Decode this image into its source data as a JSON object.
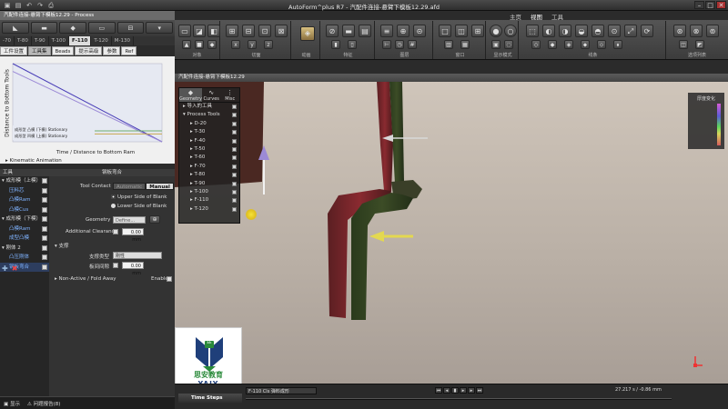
{
  "window": {
    "title": "AutoForm^plus R7 - 汽配件连接-悬臂下模板12.29.afd",
    "panel_title": "汽配件连接-悬臂下模板12.29 - Process",
    "view_title": "汽配件连接-悬臂下模板12.29",
    "menu_tabs": [
      "主页",
      "视图",
      "工具"
    ],
    "active_menu_tab": "视图"
  },
  "ribbon": {
    "groups": [
      "对象",
      "切面",
      "动画",
      "特征",
      "图层",
      "窗口",
      "显示模式",
      "线条",
      "选项列表"
    ]
  },
  "process_tabs": [
    "-70",
    "T-80",
    "T-90",
    "T-100",
    "F-110",
    "T-120",
    "M-130"
  ],
  "active_process_tab": "F-110",
  "sub_tabs": [
    "工件设置",
    "工具集",
    "Beads",
    "提示高级",
    "参数",
    "Ref"
  ],
  "active_sub_tab": "工具集",
  "chart_panel": {
    "ylabel": "Distance to Bottom Tools",
    "xlabel": "Time / Distance to Bottom Ram",
    "kinematic": "Kinematic Animation",
    "legend": [
      {
        "label": "成形型  凸模   (下模)   Stationary"
      },
      {
        "label": "成形型  凹模   (上模)   Stationary"
      }
    ]
  },
  "chart_data": {
    "type": "line",
    "title": "",
    "xlabel": "Time / Distance to Bottom Ram",
    "ylabel": "Distance to Bottom Tools",
    "series": [
      {
        "values": [
          [
            0,
            1.0
          ],
          [
            1,
            0
          ]
        ],
        "color": "#4a3fb8"
      },
      {
        "values": [
          [
            0,
            0.9
          ],
          [
            1,
            0
          ]
        ],
        "color": "#9c8ad6"
      },
      {
        "values": [
          [
            0,
            0.14
          ],
          [
            1,
            0.14
          ]
        ],
        "color": "#6fb06f"
      },
      {
        "values": [
          [
            0,
            0.1
          ],
          [
            1,
            0.1
          ]
        ],
        "color": "#c8a850"
      }
    ],
    "xlim": [
      0,
      1
    ],
    "ylim": [
      0,
      1
    ]
  },
  "tree": {
    "header": "工具",
    "items": [
      {
        "label": "成形模（上模）",
        "child": false,
        "selected": false
      },
      {
        "label": "压料芯",
        "child": true,
        "selected": false
      },
      {
        "label": "凸模Ram",
        "child": true,
        "selected": false
      },
      {
        "label": "凸模Cus",
        "child": true,
        "selected": false
      },
      {
        "label": "成形模（下模）",
        "child": false,
        "selected": false
      },
      {
        "label": "凸模Ram",
        "child": true,
        "selected": false
      },
      {
        "label": "成型凸模",
        "child": true,
        "selected": false
      },
      {
        "label": "刚体 2",
        "child": false,
        "selected": false
      },
      {
        "label": "凸压刚体",
        "child": true,
        "selected": false
      },
      {
        "label": "钢板弯合",
        "child": true,
        "selected": true
      }
    ]
  },
  "props": {
    "header": "钢板弯合",
    "tool_contact_label": "Tool Contact",
    "tool_contact_options": [
      "Automatic",
      "Manual"
    ],
    "active_contact": "Manual",
    "upper_side": "Upper Side of Blank",
    "lower_side": "Lower Side of Blank",
    "geometry_label": "Geometry",
    "geometry_value": "Define...",
    "clearance_label": "Additional Clearance",
    "clearance_value": "0.00 mm",
    "support_header": "支撑",
    "support_type_label": "支撑类型",
    "support_type_value": "刚性",
    "gap_label": "板间间隙",
    "gap_value": "0.00 mm",
    "nonactive_label": "Non-Active / Fold Away",
    "enable_label": "Enable"
  },
  "left_status": {
    "btn1": "显示",
    "btn2": "问题报告(8)"
  },
  "overlay": {
    "tabs": [
      {
        "label": "Geometry",
        "icon": "◆"
      },
      {
        "label": "Curves",
        "icon": "∿"
      },
      {
        "label": "Misc",
        "icon": "⋮"
      }
    ],
    "rows": [
      {
        "label": "导入的工具",
        "tool": false
      },
      {
        "label": "Process Tools",
        "tool": false
      },
      {
        "label": "D-20",
        "tool": true
      },
      {
        "label": "T-30",
        "tool": true
      },
      {
        "label": "F-40",
        "tool": true
      },
      {
        "label": "T-50",
        "tool": true
      },
      {
        "label": "T-60",
        "tool": true
      },
      {
        "label": "F-70",
        "tool": true
      },
      {
        "label": "T-80",
        "tool": true
      },
      {
        "label": "T-90",
        "tool": true
      },
      {
        "label": "T-100",
        "tool": true
      },
      {
        "label": "F-110",
        "tool": true
      },
      {
        "label": "T-120",
        "tool": true
      }
    ]
  },
  "legend_panel": {
    "title": "厚度变化"
  },
  "viewer_status": {
    "time_steps": "Time Steps",
    "step_value": "F-110 Cls 弹料成形",
    "coords": "27.217 s / -0.86 mm"
  },
  "logo": {
    "text_cn": "思安教育",
    "text_en": "YAJY",
    "badge": "EE"
  },
  "colors": {
    "accent": "#e3c640",
    "selection": "#2d3d5e"
  }
}
